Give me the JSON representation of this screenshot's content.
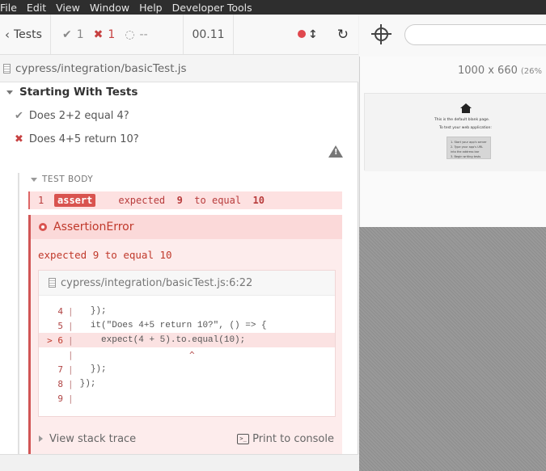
{
  "menubar": {
    "items": [
      "File",
      "Edit",
      "View",
      "Window",
      "Help",
      "Developer Tools"
    ]
  },
  "reporter": {
    "tests_label": "Tests",
    "passed": "1",
    "failed": "1",
    "pending": "--",
    "duration": "00.11",
    "spec_path": "cypress/integration/basicTest.js"
  },
  "suite": {
    "title": "Starting With Tests",
    "tests": [
      {
        "title": "Does 2+2 equal 4?",
        "state": "passed"
      },
      {
        "title": "Does 4+5 return 10?",
        "state": "failed"
      }
    ]
  },
  "command_log": {
    "section_label": "TEST BODY",
    "command": {
      "number": "1",
      "name": "assert",
      "message_prefix": "expected",
      "expected": "9",
      "mid": "to equal",
      "actual": "10"
    }
  },
  "error": {
    "name": "AssertionError",
    "message": "expected 9 to equal 10",
    "location": "cypress/integration/basicTest.js:6:22",
    "code_lines": [
      {
        "num": "4",
        "code": "  });",
        "highlight": false
      },
      {
        "num": "5",
        "code": "  it(\"Does 4+5 return 10?\", () => {",
        "highlight": false
      },
      {
        "num": "> 6",
        "code": "    expect(4 + 5).to.equal(10);",
        "highlight": true
      },
      {
        "num": "",
        "code": "",
        "highlight": false
      },
      {
        "num": "7",
        "code": "  });",
        "highlight": false
      },
      {
        "num": "8",
        "code": "});",
        "highlight": false
      },
      {
        "num": "9",
        "code": "",
        "highlight": false
      }
    ],
    "caret": "^",
    "stack_trace_label": "View stack trace",
    "print_label": "Print to console",
    "print_icon": ">_"
  },
  "preview": {
    "url_placeholder": "",
    "viewport": "1000 x 660",
    "zoom": "(26%",
    "aut": {
      "line1": "This is the default blank page.",
      "line2": "To test your web application:",
      "steps": [
        "1. Start your app's server",
        "2. Type your app's URL into the address bar",
        "3. Begin writing tests"
      ]
    }
  },
  "colors": {
    "fail": "#c74141",
    "error_bg": "#fdecec",
    "badge": "#d9534f"
  },
  "icons": [
    "chevron-left-icon",
    "check-icon",
    "x-icon",
    "spinner-icon",
    "record-icon",
    "updown-icon",
    "reload-icon",
    "file-icon",
    "warning-icon",
    "crosshair-icon",
    "home-icon",
    "terminal-icon"
  ]
}
